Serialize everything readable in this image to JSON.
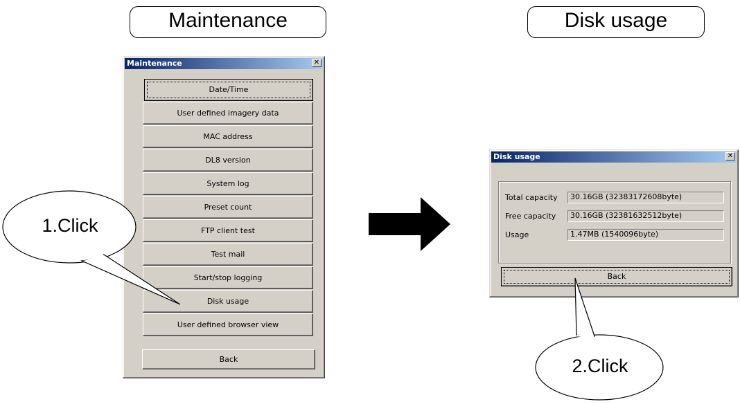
{
  "captions": {
    "left": "Maintenance",
    "right": "Disk usage"
  },
  "maintenance_window": {
    "title": "Maintenance",
    "close_glyph": "✕",
    "buttons": [
      "Date/Time",
      "User defined imagery data",
      "MAC address",
      "DL8 version",
      "System log",
      "Preset count",
      "FTP client test",
      "Test mail",
      "Start/stop logging",
      "Disk usage",
      "User defined browser view"
    ],
    "back_label": "Back"
  },
  "disk_window": {
    "title": "Disk usage",
    "close_glyph": "✕",
    "rows": [
      {
        "label": "Total capacity",
        "value": "30.16GB (32383172608byte)"
      },
      {
        "label": "Free capacity",
        "value": "30.16GB (32381632512byte)"
      },
      {
        "label": "Usage",
        "value": "1.47MB (1540096byte)"
      }
    ],
    "back_label": "Back"
  },
  "callouts": {
    "step1": "1.Click",
    "step2": "2.Click"
  }
}
